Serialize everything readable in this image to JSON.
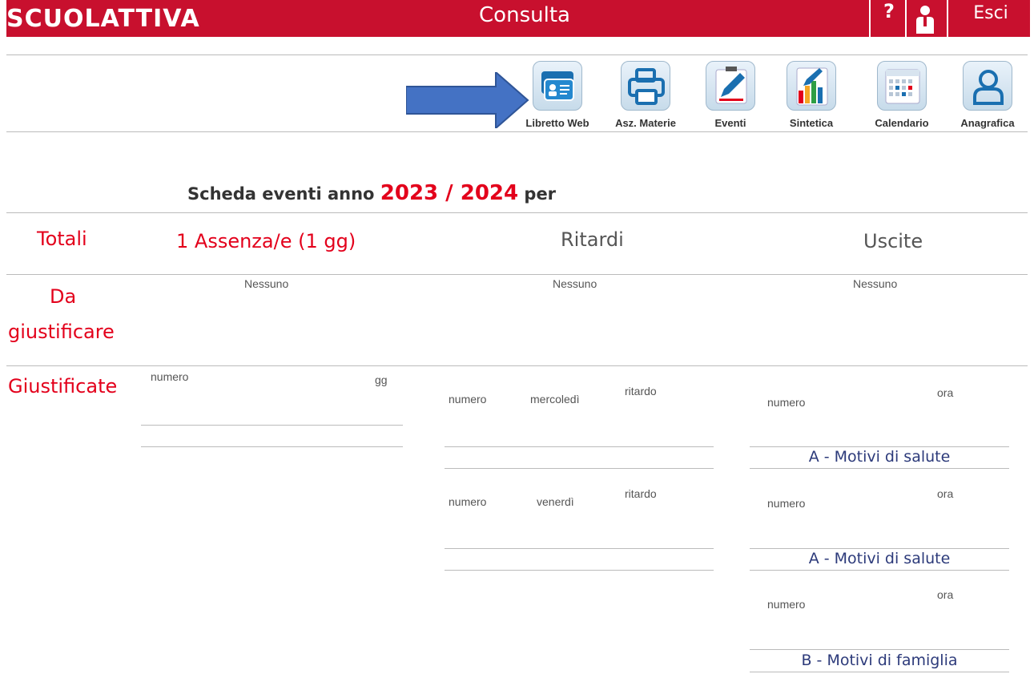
{
  "header": {
    "logo": "SCUOLATTIVA",
    "title": "Consulta",
    "help_label": "?",
    "logout_label": "Esci"
  },
  "toolbar": [
    {
      "label": "Libretto Web",
      "icon": "id-card-icon"
    },
    {
      "label": "Asz. Materie",
      "icon": "printer-icon"
    },
    {
      "label": "Eventi",
      "icon": "edit-icon"
    },
    {
      "label": "Sintetica",
      "icon": "bar-chart-icon"
    },
    {
      "label": "Calendario",
      "icon": "calendar-icon"
    },
    {
      "label": "Anagrafica",
      "icon": "user-icon"
    }
  ],
  "title": {
    "prefix": "Scheda eventi anno",
    "year": "2023 / 2024",
    "suffix": "per"
  },
  "totali": {
    "label": "Totali",
    "assenze": "1  Assenza/e (1 gg)",
    "ritardi": "Ritardi",
    "uscite": "Uscite"
  },
  "da_giustificare": {
    "label_line1": "Da",
    "label_line2": "giustificare",
    "assenze": "Nessuno",
    "ritardi": "Nessuno",
    "uscite": "Nessuno"
  },
  "giustificate": {
    "label": "Giustificate",
    "assenze": {
      "numero": "numero",
      "gg": "gg"
    },
    "ritardi": [
      {
        "numero": "numero",
        "giorno": "mercoledì",
        "tipo": "ritardo"
      },
      {
        "numero": "numero",
        "giorno": "venerdì",
        "tipo": "ritardo"
      }
    ],
    "uscite": [
      {
        "numero": "numero",
        "ora": "ora",
        "motivo": "A - Motivi di salute"
      },
      {
        "numero": "numero",
        "ora": "ora",
        "motivo": "A - Motivi di salute"
      },
      {
        "numero": "numero",
        "ora": "ora",
        "motivo": "B - Motivi di famiglia"
      }
    ]
  },
  "colors": {
    "brand_red": "#c8102e",
    "accent_red": "#e3001b",
    "arrow_blue": "#4472c4",
    "reason_blue": "#2c3a7a"
  }
}
